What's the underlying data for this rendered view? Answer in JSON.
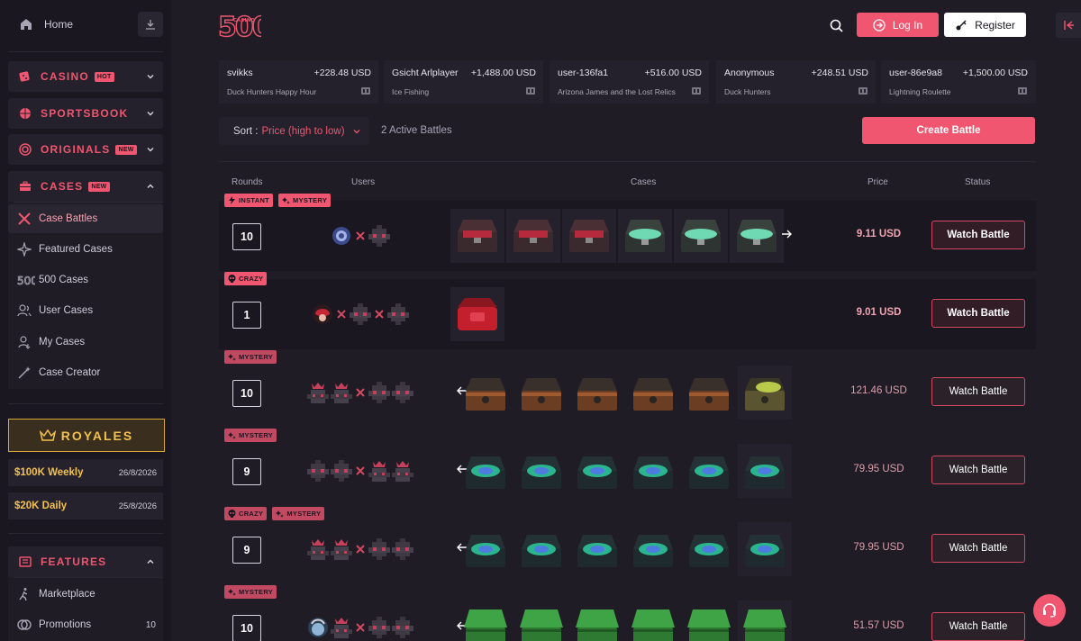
{
  "sidebar": {
    "home": "Home",
    "categories": {
      "casino": {
        "label": "CASINO",
        "badge": "HOT"
      },
      "sportsbook": {
        "label": "SPORTSBOOK"
      },
      "originals": {
        "label": "ORIGINALS",
        "badge": "NEW"
      },
      "cases": {
        "label": "CASES",
        "badge": "NEW"
      }
    },
    "case_items": [
      {
        "label": "Case Battles",
        "icon": "swords-icon"
      },
      {
        "label": "Featured Cases",
        "icon": "sparkle-icon"
      },
      {
        "label": "500 Cases",
        "icon": "brand-500-icon"
      },
      {
        "label": "User Cases",
        "icon": "users-icon"
      },
      {
        "label": "My Cases",
        "icon": "user-icon"
      },
      {
        "label": "Case Creator",
        "icon": "wand-icon"
      }
    ],
    "royales": {
      "label": "ROYALES"
    },
    "prizes": [
      {
        "label": "$100K Weekly",
        "date": "26/8/2026"
      },
      {
        "label": "$20K Daily",
        "date": "25/8/2026"
      }
    ],
    "features": {
      "label": "FEATURES",
      "items": [
        {
          "label": "Marketplace",
          "icon": "runner-icon"
        },
        {
          "label": "Promotions",
          "icon": "coin-icon",
          "count": "10"
        }
      ]
    }
  },
  "header": {
    "logo_number": "500",
    "logo_word": "CASINO",
    "login": "Log In",
    "register": "Register"
  },
  "ticker": [
    {
      "user": "svikks",
      "amount": "+228.48  USD",
      "game": "Duck Hunters Happy Hour"
    },
    {
      "user": "Gsicht Arlplayer",
      "amount": "+1,488.00  USD",
      "game": "Ice Fishing"
    },
    {
      "user": "user-136fa1",
      "amount": "+516.00  USD",
      "game": "Arizona James and the Lost Relics"
    },
    {
      "user": "Anonymous",
      "amount": "+248.51  USD",
      "game": "Duck Hunters"
    },
    {
      "user": "user-86e9a8",
      "amount": "+1,500.00  USD",
      "game": "Lightning Roulette"
    }
  ],
  "controls": {
    "sort_key": "Sort :",
    "sort_value": "Price (high to low)",
    "active_battles": "2 Active Battles",
    "create_battle": "Create Battle"
  },
  "table": {
    "headers": {
      "rounds": "Rounds",
      "users": "Users",
      "cases": "Cases",
      "price": "Price",
      "status": "Status"
    }
  },
  "battles": [
    {
      "tags": [
        "INSTANT",
        "MYSTERY"
      ],
      "rounds": "10",
      "price": "9.11 USD",
      "action": "Watch Battle",
      "active": true
    },
    {
      "tags": [
        "CRAZY"
      ],
      "rounds": "1",
      "price": "9.01 USD",
      "action": "Watch Battle",
      "active": true
    },
    {
      "tags": [
        "MYSTERY"
      ],
      "rounds": "10",
      "price": "121.46 USD",
      "action": "Watch Battle",
      "active": false
    },
    {
      "tags": [
        "MYSTERY"
      ],
      "rounds": "9",
      "price": "79.95 USD",
      "action": "Watch Battle",
      "active": false
    },
    {
      "tags": [
        "CRAZY",
        "MYSTERY"
      ],
      "rounds": "9",
      "price": "79.95 USD",
      "action": "Watch Battle",
      "active": false
    },
    {
      "tags": [
        "MYSTERY"
      ],
      "rounds": "10",
      "price": "51.57 USD",
      "action": "Watch Battle",
      "active": false
    }
  ],
  "colors": {
    "accent": "#f0566f",
    "gold": "#f2c14e",
    "bg": "#1f1c26",
    "panel": "#1a1720"
  }
}
